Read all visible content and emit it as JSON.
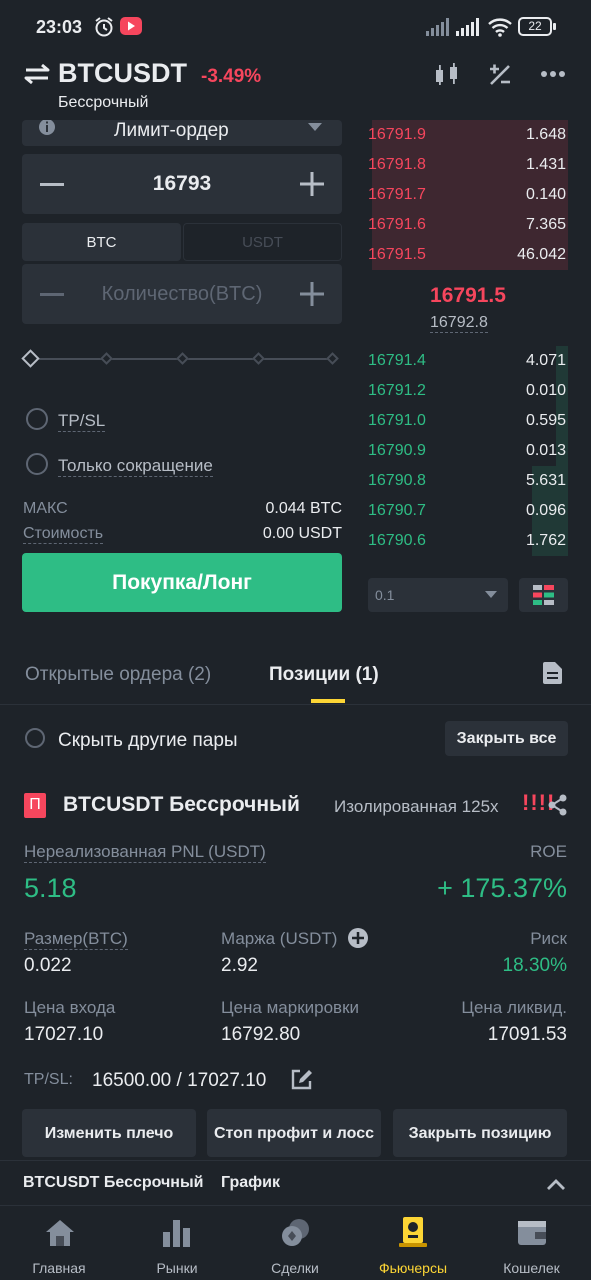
{
  "status_bar": {
    "time": "23:03",
    "battery": "22"
  },
  "header": {
    "symbol": "BTCUSDT",
    "change": "-3.49%",
    "contract_type": "Бессрочный"
  },
  "order_form": {
    "order_type": "Лимит-ордер",
    "price": "16793",
    "unit_tabs": [
      "BTC",
      "USDT"
    ],
    "quantity_placeholder": "Количество(BTC)",
    "tpsl_label": "TP/SL",
    "reduce_only_label": "Только сокращение",
    "max_label": "МАКС",
    "max_value": "0.044 BTC",
    "cost_label": "Стоимость",
    "cost_value": "0.00 USDT",
    "buy_button": "Покупка/Лонг"
  },
  "orderbook": {
    "asks": [
      {
        "price": "16791.9",
        "qty": "1.648",
        "depth": 0.98
      },
      {
        "price": "16791.8",
        "qty": "1.431",
        "depth": 0.98
      },
      {
        "price": "16791.7",
        "qty": "0.140",
        "depth": 0.98
      },
      {
        "price": "16791.6",
        "qty": "7.365",
        "depth": 0.98
      },
      {
        "price": "16791.5",
        "qty": "46.042",
        "depth": 0.98
      }
    ],
    "last_price": "16791.5",
    "mark_price": "16792.8",
    "bids": [
      {
        "price": "16791.4",
        "qty": "4.071",
        "depth": 0.06
      },
      {
        "price": "16791.2",
        "qty": "0.010",
        "depth": 0.06
      },
      {
        "price": "16791.0",
        "qty": "0.595",
        "depth": 0.06
      },
      {
        "price": "16790.9",
        "qty": "0.013",
        "depth": 0.06
      },
      {
        "price": "16790.8",
        "qty": "5.631",
        "depth": 0.18
      },
      {
        "price": "16790.7",
        "qty": "0.096",
        "depth": 0.18
      },
      {
        "price": "16790.6",
        "qty": "1.762",
        "depth": 0.18
      }
    ],
    "step": "0.1"
  },
  "tabs": {
    "open_orders": "Открытые ордера (2)",
    "positions": "Позиции (1)"
  },
  "hide_pairs_label": "Скрыть другие пары",
  "close_all_label": "Закрыть все",
  "position": {
    "badge": "П",
    "title": "BTCUSDT Бессрочный",
    "margin_mode": "Изолированная 125x",
    "warning": "!!!!",
    "pnl_label": "Нереализованная PNL (USDT)",
    "pnl_value": "5.18",
    "roe_label": "ROE",
    "roe_value": "+ 175.37%",
    "size_label": "Размер(BTC)",
    "size_value": "0.022",
    "margin_label": "Маржа (USDT)",
    "margin_value": "2.92",
    "risk_label": "Риск",
    "risk_value": "18.30%",
    "entry_label": "Цена входа",
    "entry_value": "17027.10",
    "mark_label": "Цена маркировки",
    "mark_value": "16792.80",
    "liq_label": "Цена ликвид.",
    "liq_value": "17091.53",
    "tpsl_label": "TP/SL:",
    "tpsl_value": "16500.00 / 17027.10",
    "buttons": [
      "Изменить плечо",
      "Стоп профит и лосс",
      "Закрыть позицию"
    ]
  },
  "chart_bar": {
    "title": "BTCUSDT Бессрочный",
    "chart_label": "График"
  },
  "bottom_nav": [
    "Главная",
    "Рынки",
    "Сделки",
    "Фьючерсы",
    "Кошелек"
  ],
  "colors": {
    "green": "#2ebd85",
    "red": "#f6465d",
    "accent": "#fcd535",
    "bg": "#1e2329"
  }
}
